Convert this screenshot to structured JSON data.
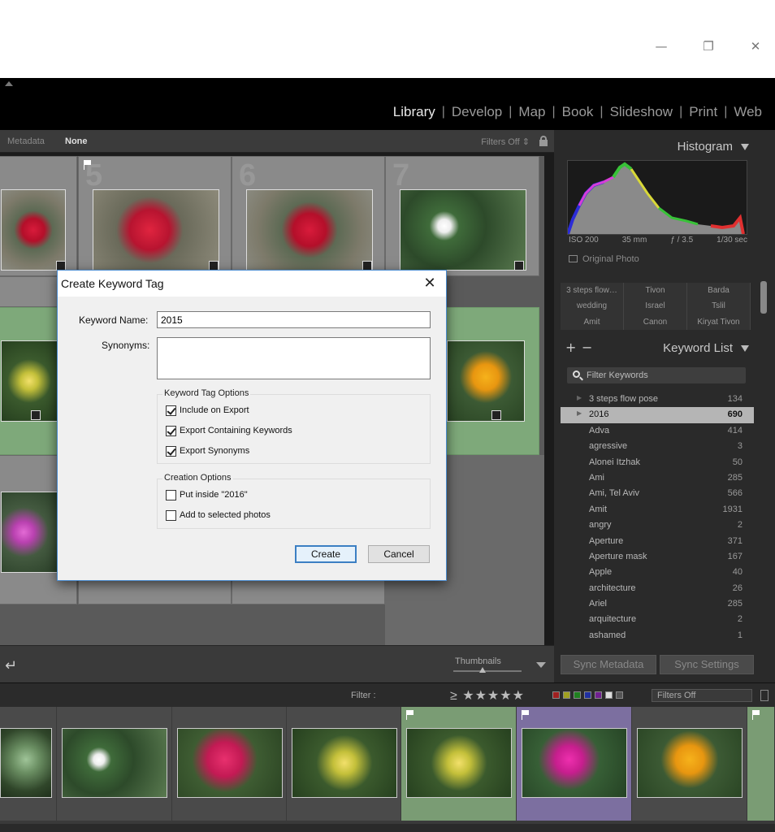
{
  "window": {
    "minimize_glyph": "—",
    "restore_glyph": "❐",
    "close_glyph": "✕"
  },
  "modules": [
    "Library",
    "Develop",
    "Map",
    "Book",
    "Slideshow",
    "Print",
    "Web"
  ],
  "active_module": "Library",
  "filterbar": {
    "metadata": "Metadata",
    "none": "None",
    "filters_off": "Filters Off ⇕"
  },
  "grid": {
    "cell_numbers": [
      "5",
      "6",
      "7"
    ]
  },
  "toolbar": {
    "thumbnails_label": "Thumbnails"
  },
  "histogram": {
    "title": "Histogram",
    "iso": "ISO 200",
    "focal": "35 mm",
    "aperture": "ƒ / 3.5",
    "shutter": "1/30 sec",
    "original_photo": "Original Photo"
  },
  "keyword_suggestions": [
    "3 steps flow…",
    "Tivon",
    "Barda",
    "wedding",
    "Israel",
    "Tslil",
    "Amit",
    "Canon",
    "Kiryat Tivon"
  ],
  "keyword_list": {
    "title": "Keyword List",
    "filter_placeholder": "Filter Keywords",
    "items": [
      {
        "name": "3 steps flow pose",
        "count": "134",
        "arrow": "▶"
      },
      {
        "name": "2016",
        "count": "690",
        "arrow": "▶"
      },
      {
        "name": "Adva",
        "count": "414",
        "arrow": ""
      },
      {
        "name": "agressive",
        "count": "3",
        "arrow": ""
      },
      {
        "name": "Alonei Itzhak",
        "count": "50",
        "arrow": ""
      },
      {
        "name": "Ami",
        "count": "285",
        "arrow": ""
      },
      {
        "name": "Ami, Tel Aviv",
        "count": "566",
        "arrow": ""
      },
      {
        "name": "Amit",
        "count": "1931",
        "arrow": ""
      },
      {
        "name": "angry",
        "count": "2",
        "arrow": ""
      },
      {
        "name": "Aperture",
        "count": "371",
        "arrow": ""
      },
      {
        "name": "Aperture mask",
        "count": "167",
        "arrow": ""
      },
      {
        "name": "Apple",
        "count": "40",
        "arrow": ""
      },
      {
        "name": "architecture",
        "count": "26",
        "arrow": ""
      },
      {
        "name": "Ariel",
        "count": "285",
        "arrow": ""
      },
      {
        "name": "arquitecture",
        "count": "2",
        "arrow": ""
      },
      {
        "name": "ashamed",
        "count": "1",
        "arrow": ""
      }
    ],
    "selected_index": 1
  },
  "sync": {
    "metadata": "Sync Metadata",
    "settings": "Sync Settings"
  },
  "filmbar": {
    "filter_label": "Filter :",
    "stars": "≥ ★★★★★",
    "filters_off": "Filters Off"
  },
  "dialog": {
    "title": "Create Keyword Tag",
    "keyword_name_label": "Keyword Name:",
    "keyword_name_value": "2015",
    "synonyms_label": "Synonyms:",
    "synonyms_value": "",
    "tag_options_title": "Keyword Tag Options",
    "include_on_export": "Include on Export",
    "export_containing": "Export Containing Keywords",
    "export_synonyms": "Export Synonyms",
    "creation_options_title": "Creation Options",
    "put_inside": "Put inside \"2016\"",
    "add_to_selected": "Add to selected photos",
    "create_button": "Create",
    "cancel_button": "Cancel"
  }
}
